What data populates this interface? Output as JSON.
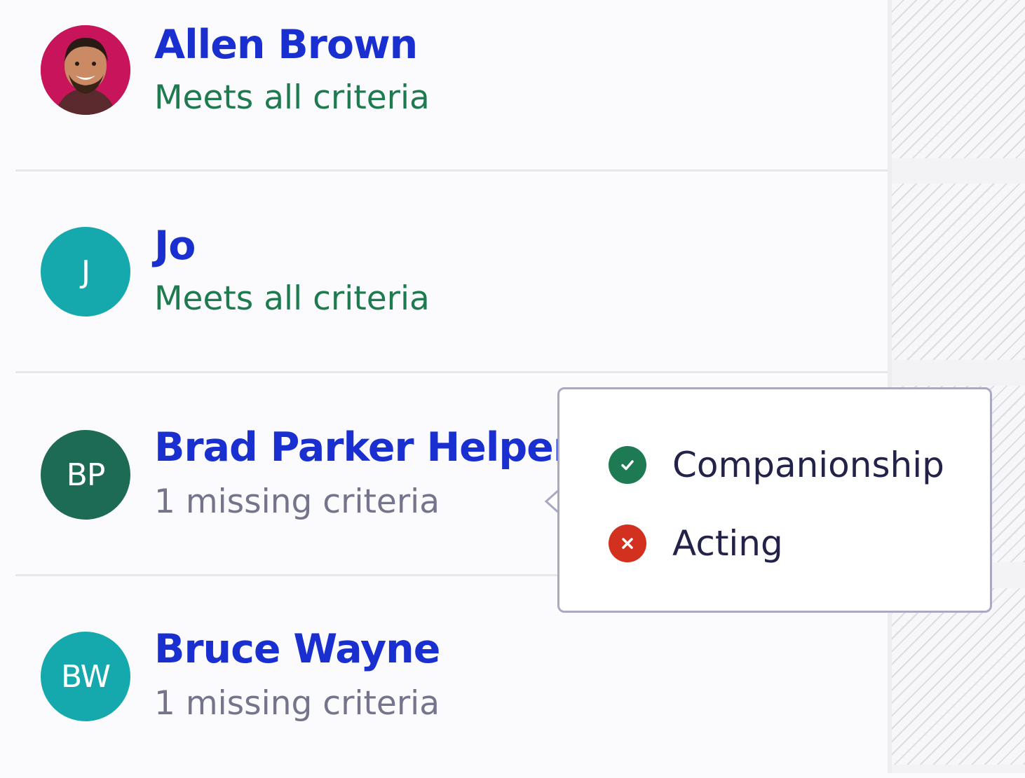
{
  "colors": {
    "name_link": "#1a2fd0",
    "status_ok": "#1e7a4f",
    "status_missing": "#74748c",
    "avatar_teal": "#15a8ad",
    "avatar_green": "#1d6b55",
    "avatar_photo_bg": "#c8145a",
    "check_green": "#1d7a52",
    "cross_red": "#d3311f"
  },
  "people": [
    {
      "name": "Allen Brown",
      "status": "Meets all criteria",
      "avatar_type": "photo",
      "initials": ""
    },
    {
      "name": "Jo",
      "status": "Meets all criteria",
      "avatar_type": "initials",
      "initials": "J"
    },
    {
      "name": "Brad Parker Helper",
      "status": "1 missing criteria",
      "avatar_type": "initials",
      "initials": "BP"
    },
    {
      "name": "Bruce Wayne",
      "status": "1 missing criteria",
      "avatar_type": "initials",
      "initials": "BW"
    }
  ],
  "popover": {
    "criteria": [
      {
        "label": "Companionship",
        "met": true,
        "icon": "check-circle-icon"
      },
      {
        "label": "Acting",
        "met": false,
        "icon": "x-circle-icon"
      }
    ]
  }
}
